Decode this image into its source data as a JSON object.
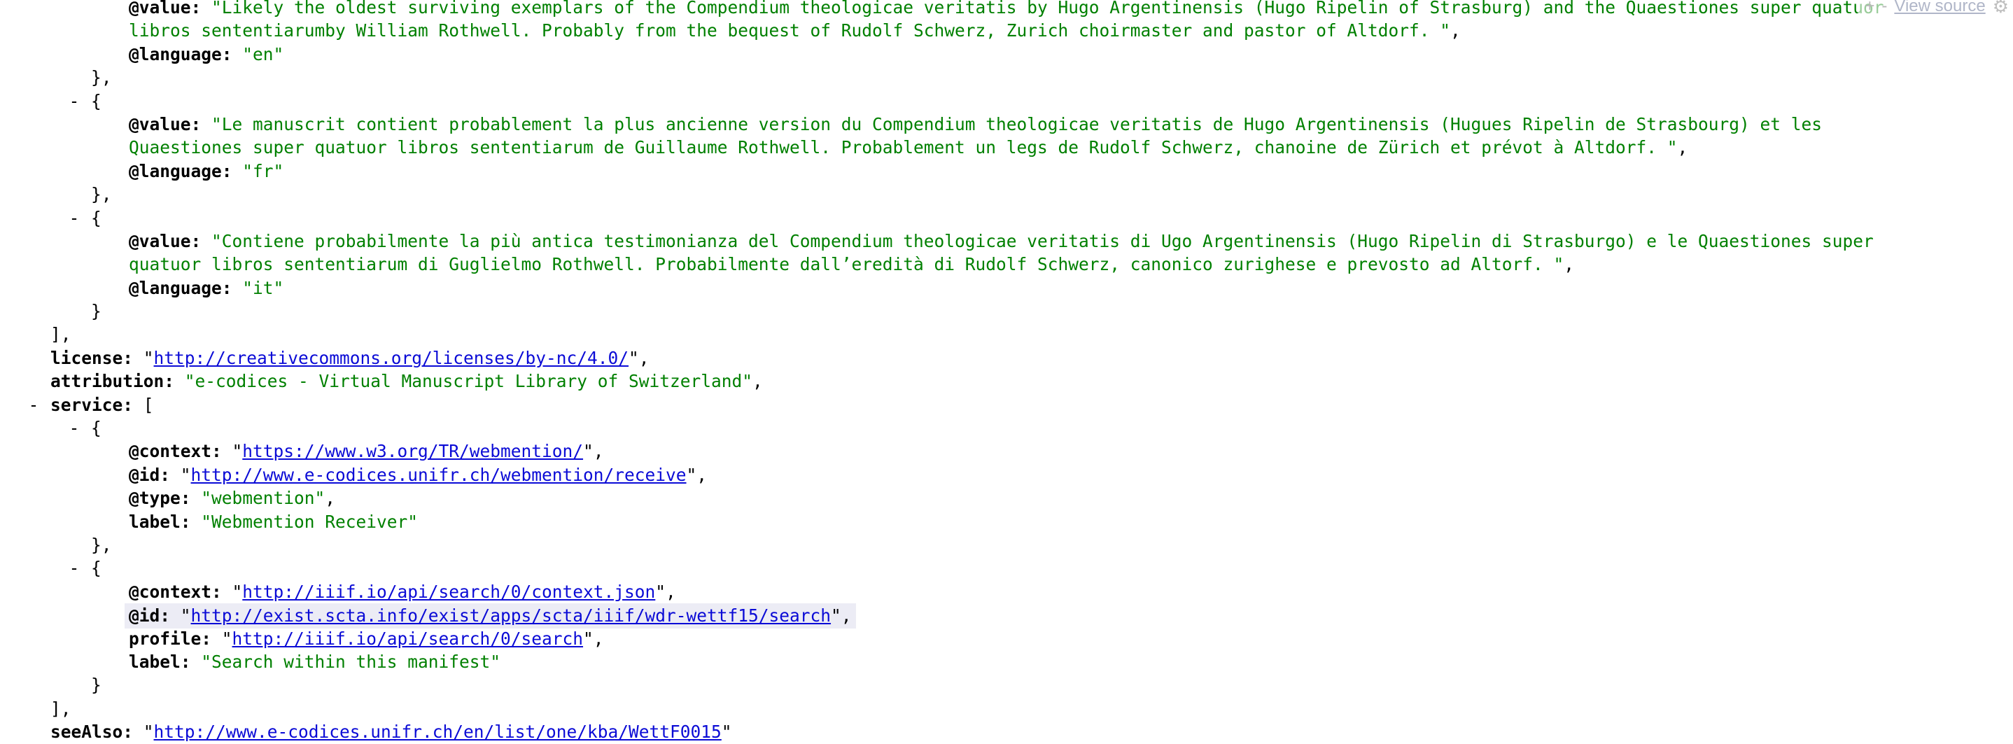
{
  "toolbar": {
    "expand_all": "+",
    "collapse_all": "-",
    "view_source": "View source",
    "settings_icon": "gear-icon"
  },
  "lines": [
    {
      "i": 0,
      "t": "",
      "parts": [
        {
          "c": "key",
          "v": "@value: "
        },
        {
          "c": "str",
          "v": "\"Likely the oldest surviving exemplars of the Compendium theologicae veritatis by Hugo Argentinensis (Hugo Ripelin of Strasburg) and the Quaestiones super quatuor"
        }
      ]
    },
    {
      "i": 0,
      "t": "",
      "parts": [
        {
          "c": "str",
          "v": "libros sententiarumby William Rothwell. Probably from the bequest of Rudolf Schwerz, Zurich choirmaster and pastor of Altdorf. \""
        },
        {
          "c": "p",
          "v": ","
        }
      ]
    },
    {
      "i": 0,
      "t": "",
      "parts": [
        {
          "c": "key",
          "v": "@language: "
        },
        {
          "c": "str",
          "v": "\"en\""
        }
      ]
    },
    {
      "i": 1,
      "t": "",
      "parts": [
        {
          "c": "p",
          "v": "},"
        }
      ]
    },
    {
      "i": 1,
      "t": "-",
      "parts": [
        {
          "c": "p",
          "v": "{"
        }
      ]
    },
    {
      "i": 0,
      "t": "",
      "parts": [
        {
          "c": "key",
          "v": "@value: "
        },
        {
          "c": "str",
          "v": "\"Le manuscrit contient probablement la plus ancienne version du Compendium theologicae veritatis de Hugo Argentinensis (Hugues Ripelin de Strasbourg) et les"
        }
      ]
    },
    {
      "i": 0,
      "t": "",
      "parts": [
        {
          "c": "str",
          "v": "Quaestiones super quatuor libros sententiarum de Guillaume Rothwell. Probablement un legs de Rudolf Schwerz, chanoine de Zürich et prévot à Altdorf. \""
        },
        {
          "c": "p",
          "v": ","
        }
      ]
    },
    {
      "i": 0,
      "t": "",
      "parts": [
        {
          "c": "key",
          "v": "@language: "
        },
        {
          "c": "str",
          "v": "\"fr\""
        }
      ]
    },
    {
      "i": 1,
      "t": "",
      "parts": [
        {
          "c": "p",
          "v": "},"
        }
      ]
    },
    {
      "i": 1,
      "t": "-",
      "parts": [
        {
          "c": "p",
          "v": "{"
        }
      ]
    },
    {
      "i": 0,
      "t": "",
      "parts": [
        {
          "c": "key",
          "v": "@value: "
        },
        {
          "c": "str",
          "v": "\"Contiene probabilmente la più antica testimonianza del Compendium theologicae veritatis di Ugo Argentinensis (Hugo Ripelin di Strasburgo) e le Quaestiones super"
        }
      ]
    },
    {
      "i": 0,
      "t": "",
      "parts": [
        {
          "c": "str",
          "v": "quatuor libros sententiarum di Guglielmo Rothwell. Probabilmente dall’eredità di Rudolf Schwerz, canonico zurighese e prevosto ad Altorf. \""
        },
        {
          "c": "p",
          "v": ","
        }
      ]
    },
    {
      "i": 0,
      "t": "",
      "parts": [
        {
          "c": "key",
          "v": "@language: "
        },
        {
          "c": "str",
          "v": "\"it\""
        }
      ]
    },
    {
      "i": 1,
      "t": "",
      "parts": [
        {
          "c": "p",
          "v": "}"
        }
      ]
    },
    {
      "i": 2,
      "t": "",
      "parts": [
        {
          "c": "p",
          "v": "],"
        }
      ]
    },
    {
      "i": 2,
      "t": "",
      "parts": [
        {
          "c": "key",
          "v": "license: "
        },
        {
          "c": "p",
          "v": "\""
        },
        {
          "c": "url",
          "v": "http://creativecommons.org/licenses/by-nc/4.0/"
        },
        {
          "c": "p",
          "v": "\","
        }
      ]
    },
    {
      "i": 2,
      "t": "",
      "parts": [
        {
          "c": "key",
          "v": "attribution: "
        },
        {
          "c": "str",
          "v": "\"e-codices - Virtual Manuscript Library of Switzerland\""
        },
        {
          "c": "p",
          "v": ","
        }
      ]
    },
    {
      "i": 2,
      "t": "-",
      "parts": [
        {
          "c": "key",
          "v": "service: "
        },
        {
          "c": "p",
          "v": "["
        }
      ]
    },
    {
      "i": 1,
      "t": "-",
      "parts": [
        {
          "c": "p",
          "v": "{"
        }
      ]
    },
    {
      "i": 0,
      "t": "",
      "parts": [
        {
          "c": "key",
          "v": "@context: "
        },
        {
          "c": "p",
          "v": "\""
        },
        {
          "c": "url",
          "v": "https://www.w3.org/TR/webmention/"
        },
        {
          "c": "p",
          "v": "\","
        }
      ]
    },
    {
      "i": 0,
      "t": "",
      "parts": [
        {
          "c": "key",
          "v": "@id: "
        },
        {
          "c": "p",
          "v": "\""
        },
        {
          "c": "url",
          "v": "http://www.e-codices.unifr.ch/webmention/receive"
        },
        {
          "c": "p",
          "v": "\","
        }
      ]
    },
    {
      "i": 0,
      "t": "",
      "parts": [
        {
          "c": "key",
          "v": "@type: "
        },
        {
          "c": "str",
          "v": "\"webmention\""
        },
        {
          "c": "p",
          "v": ","
        }
      ]
    },
    {
      "i": 0,
      "t": "",
      "parts": [
        {
          "c": "key",
          "v": "label: "
        },
        {
          "c": "str",
          "v": "\"Webmention Receiver\""
        }
      ]
    },
    {
      "i": 1,
      "t": "",
      "parts": [
        {
          "c": "p",
          "v": "},"
        }
      ]
    },
    {
      "i": 1,
      "t": "-",
      "parts": [
        {
          "c": "p",
          "v": "{"
        }
      ]
    },
    {
      "i": 0,
      "t": "",
      "parts": [
        {
          "c": "key",
          "v": "@context: "
        },
        {
          "c": "p",
          "v": "\""
        },
        {
          "c": "url",
          "v": "http://iiif.io/api/search/0/context.json"
        },
        {
          "c": "p",
          "v": "\","
        }
      ]
    },
    {
      "i": 0,
      "t": "",
      "hl": true,
      "parts": [
        {
          "c": "key",
          "v": "@id: "
        },
        {
          "c": "p",
          "v": "\""
        },
        {
          "c": "url",
          "v": "http://exist.scta.info/exist/apps/scta/iiif/wdr-wettf15/search"
        },
        {
          "c": "p",
          "v": "\","
        }
      ]
    },
    {
      "i": 0,
      "t": "",
      "parts": [
        {
          "c": "key",
          "v": "profile: "
        },
        {
          "c": "p",
          "v": "\""
        },
        {
          "c": "url",
          "v": "http://iiif.io/api/search/0/search"
        },
        {
          "c": "p",
          "v": "\","
        }
      ]
    },
    {
      "i": 0,
      "t": "",
      "parts": [
        {
          "c": "key",
          "v": "label: "
        },
        {
          "c": "str",
          "v": "\"Search within this manifest\""
        }
      ]
    },
    {
      "i": 1,
      "t": "",
      "parts": [
        {
          "c": "p",
          "v": "}"
        }
      ]
    },
    {
      "i": 2,
      "t": "",
      "parts": [
        {
          "c": "p",
          "v": "],"
        }
      ]
    },
    {
      "i": 2,
      "t": "",
      "parts": [
        {
          "c": "key",
          "v": "seeAlso: "
        },
        {
          "c": "p",
          "v": "\""
        },
        {
          "c": "url",
          "v": "http://www.e-codices.unifr.ch/en/list/one/kba/WettF0015"
        },
        {
          "c": "p",
          "v": "\""
        }
      ]
    }
  ]
}
